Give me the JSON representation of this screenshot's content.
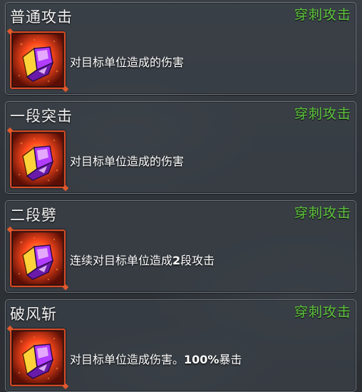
{
  "skills": [
    {
      "name": "普通攻击",
      "type": "穿刺攻击",
      "desc": [
        {
          "t": "对目标单位造成的伤害",
          "b": false
        }
      ],
      "icon": "crystal-gauntlet-icon"
    },
    {
      "name": "一段突击",
      "type": "穿刺攻击",
      "desc": [
        {
          "t": "对目标单位造成的伤害",
          "b": false
        }
      ],
      "icon": "crystal-gauntlet-icon"
    },
    {
      "name": "二段劈",
      "type": "穿刺攻击",
      "desc": [
        {
          "t": "连续对目标单位造成",
          "b": false
        },
        {
          "t": "2",
          "b": true
        },
        {
          "t": "段攻击",
          "b": false
        }
      ],
      "icon": "crystal-gauntlet-icon"
    },
    {
      "name": "破风斩",
      "type": "穿刺攻击",
      "desc": [
        {
          "t": "对目标单位造成伤害。",
          "b": false
        },
        {
          "t": "100%",
          "b": true
        },
        {
          "t": "暴击",
          "b": false
        }
      ],
      "icon": "crystal-gauntlet-icon"
    }
  ],
  "colors": {
    "attack_type": "#5fc63e",
    "icon_border": "#d24a27",
    "card_border": "#6e757c"
  }
}
